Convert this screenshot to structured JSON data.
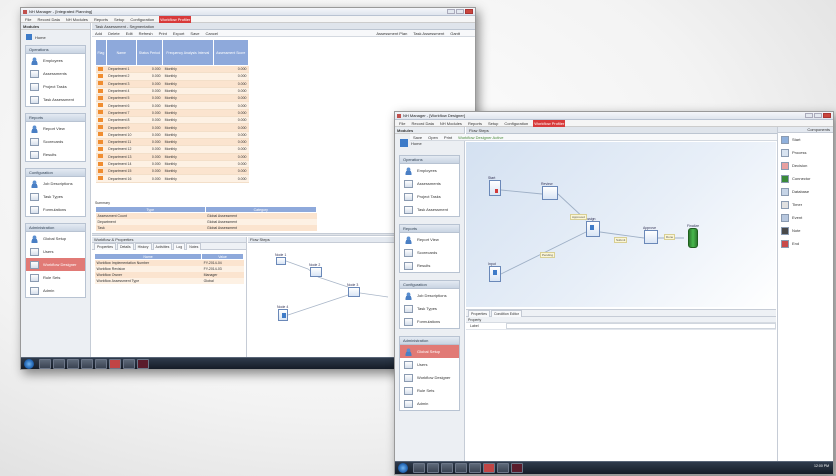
{
  "window1": {
    "title": "NH Manager - [Integrated Planning]",
    "menu": [
      "File",
      "Record Data",
      "NH Modules",
      "Reports",
      "Setup",
      "Configuration",
      "Workflow Profiler"
    ],
    "menu_highlight_index": 6,
    "sidebar": {
      "header": "Modules",
      "home_label": "Home",
      "sections": [
        {
          "title": "Operations",
          "items": [
            "Employees",
            "Assessments",
            "Project Tasks",
            "Task Assessment"
          ]
        },
        {
          "title": "Reports",
          "items": [
            "Report View",
            "Scorecards",
            "Results"
          ]
        },
        {
          "title": "Configuration",
          "items": [
            "Job Descriptions",
            "Task Types",
            "Formulations"
          ]
        },
        {
          "title": "Administration",
          "items": [
            "Global Setup",
            "Users",
            "Workflow Designer",
            "Rule Sets",
            "Admin"
          ]
        }
      ],
      "selected_item": "Workflow Designer"
    },
    "tab_title": "Task Assessment - Segmentation",
    "toolbar": [
      "Add",
      "Delete",
      "Edit",
      "Refresh",
      "Print",
      "Export",
      "Save",
      "Cancel"
    ],
    "toolbar_right": [
      "Assessment Plan",
      "Task Assessment",
      "Gantt"
    ],
    "grid_headers": [
      "Flag",
      "Name",
      "Status Period",
      "Frequency Analysis Interval",
      "Assessment Score"
    ],
    "grid_rows": [
      [
        "Department 1",
        "0.000",
        "Monthly",
        "0.000"
      ],
      [
        "Department 2",
        "0.000",
        "Monthly",
        "0.000"
      ],
      [
        "Department 3",
        "0.000",
        "Monthly",
        "0.000"
      ],
      [
        "Department 4",
        "0.000",
        "Monthly",
        "0.000"
      ],
      [
        "Department 5",
        "0.000",
        "Monthly",
        "0.000"
      ],
      [
        "Department 6",
        "0.000",
        "Monthly",
        "0.000"
      ],
      [
        "Department 7",
        "0.000",
        "Monthly",
        "0.000"
      ],
      [
        "Department 8",
        "0.000",
        "Monthly",
        "0.000"
      ],
      [
        "Department 9",
        "0.000",
        "Monthly",
        "0.000"
      ],
      [
        "Department 10",
        "0.000",
        "Monthly",
        "0.000"
      ],
      [
        "Department 11",
        "0.000",
        "Monthly",
        "0.000"
      ],
      [
        "Department 12",
        "0.000",
        "Monthly",
        "0.000"
      ],
      [
        "Department 13",
        "0.000",
        "Monthly",
        "0.000"
      ],
      [
        "Department 14",
        "0.000",
        "Monthly",
        "0.000"
      ],
      [
        "Department 15",
        "0.000",
        "Monthly",
        "0.000"
      ],
      [
        "Department 16",
        "0.000",
        "Monthly",
        "0.000"
      ]
    ],
    "summary_title": "Summary",
    "summary_headers": [
      "Type",
      "Category"
    ],
    "summary_rows": [
      [
        "Assessment Count",
        "Global Assessment"
      ],
      [
        "Department",
        "Global Assessment"
      ],
      [
        "Task",
        "Global Assessment"
      ]
    ],
    "lower_title": "Workflow & Properties",
    "lower_tabs": [
      "Properties",
      "Details",
      "History",
      "Activities",
      "Log",
      "Notes"
    ],
    "props_headers": [
      "Name",
      "Value"
    ],
    "props_rows": [
      [
        "Workflow Implementation Number",
        "FY-2014-04"
      ],
      [
        "Workflow Revision",
        "FY-2014-03"
      ],
      [
        "Workflow Owner",
        "Manager"
      ],
      [
        "Workflow Assessment Type",
        "Global"
      ]
    ],
    "diagram_title": "Flow Steps",
    "diagram_nodes": [
      "Node 1",
      "Node 2",
      "Node 3",
      "Node 4"
    ]
  },
  "window2": {
    "title": "NH Manager - [Workflow Designer]",
    "menu": [
      "File",
      "Record Data",
      "NH Modules",
      "Reports",
      "Setup",
      "Configuration",
      "Workflow Profiler"
    ],
    "menu_highlight_index": 6,
    "sidebar": {
      "header": "Modules",
      "home_label": "Home",
      "sections": [
        {
          "title": "Operations",
          "items": [
            "Employees",
            "Assessments",
            "Project Tasks",
            "Task Assessment"
          ]
        },
        {
          "title": "Reports",
          "items": [
            "Report View",
            "Scorecards",
            "Results"
          ]
        },
        {
          "title": "Configuration",
          "items": [
            "Job Descriptions",
            "Task Types",
            "Formulations"
          ]
        },
        {
          "title": "Administration",
          "items": [
            "Global Setup",
            "Users",
            "Workflow Designer",
            "Rule Sets",
            "Admin"
          ]
        }
      ],
      "selected_item": "Global Setup"
    },
    "tab_title": "Flow Steps",
    "toolbar": [
      "Save",
      "Open",
      "Print"
    ],
    "toolbar_status": "Workflow Designer Active",
    "nodes": [
      "Start",
      "Review",
      "Assign",
      "Approve",
      "Finalize",
      "Input"
    ],
    "edge_labels": [
      "Approved",
      "Pending",
      "Submit",
      "Done"
    ],
    "palette_title": "Components",
    "palette": [
      "Start",
      "Process",
      "Decision",
      "Connector",
      "Database",
      "Timer",
      "Event",
      "Note",
      "End"
    ],
    "props_tabs": [
      "Properties",
      "Condition Editor"
    ],
    "props_header": "Property",
    "props_row": [
      "Label",
      ""
    ]
  },
  "taskbar": {
    "clock": "12:00 PM"
  },
  "colors": {
    "accent_red": "#d83a3a",
    "header_blue": "#8ea9db",
    "row_peach": "#fbe4cf",
    "node_green": "#47b84d"
  }
}
